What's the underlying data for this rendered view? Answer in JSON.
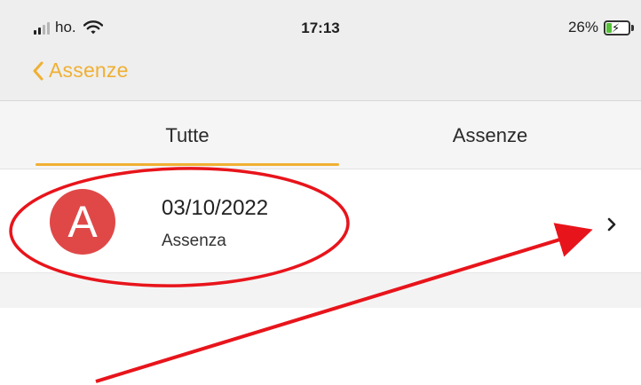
{
  "status_bar": {
    "carrier": "ho.",
    "time": "17:13",
    "battery_percent": "26%",
    "battery_level": 0.26,
    "charging": true,
    "icons": [
      "signal-icon",
      "wifi-icon",
      "battery-icon",
      "charging-bolt-icon"
    ]
  },
  "nav": {
    "back_label": "Assenze",
    "back_icon": "chevron-left-icon"
  },
  "tabs": [
    {
      "label": "Tutte",
      "selected": true
    },
    {
      "label": "Assenze",
      "selected": false
    }
  ],
  "list": {
    "items": [
      {
        "avatar_letter": "A",
        "date": "03/10/2022",
        "type": "Assenza",
        "disclosure_icon": "chevron-right-icon"
      }
    ]
  },
  "annotation": {
    "shapes": [
      "red-ellipse",
      "red-arrow"
    ]
  },
  "colors": {
    "accent": "#f0b033",
    "avatar_bg": "#e04848",
    "annotation": "#e8141b",
    "battery_fill": "#56c03a"
  }
}
